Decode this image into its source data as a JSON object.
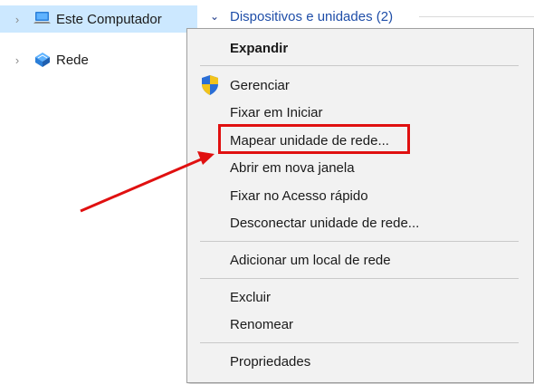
{
  "nav": {
    "items": [
      {
        "label": "Este Computador",
        "icon": "computer-icon",
        "selected": true
      },
      {
        "label": "Rede",
        "icon": "network-icon",
        "selected": false
      }
    ]
  },
  "group": {
    "label": "Dispositivos e unidades (2)"
  },
  "menu": {
    "items": [
      {
        "label": "Expandir",
        "bold": true
      },
      {
        "label": "Gerenciar",
        "icon": "uac-shield-icon"
      },
      {
        "label": "Fixar em Iniciar"
      },
      {
        "label": "Mapear unidade de rede...",
        "highlighted": true
      },
      {
        "label": "Abrir em nova janela"
      },
      {
        "label": "Fixar no Acesso rápido"
      },
      {
        "label": "Desconectar unidade de rede..."
      },
      {
        "label": "Adicionar um local de rede"
      },
      {
        "label": "Excluir"
      },
      {
        "label": "Renomear"
      },
      {
        "label": "Propriedades"
      }
    ]
  },
  "colors": {
    "highlight": "#e01010",
    "selection": "#cce8ff",
    "menu_bg": "#f2f2f2"
  }
}
